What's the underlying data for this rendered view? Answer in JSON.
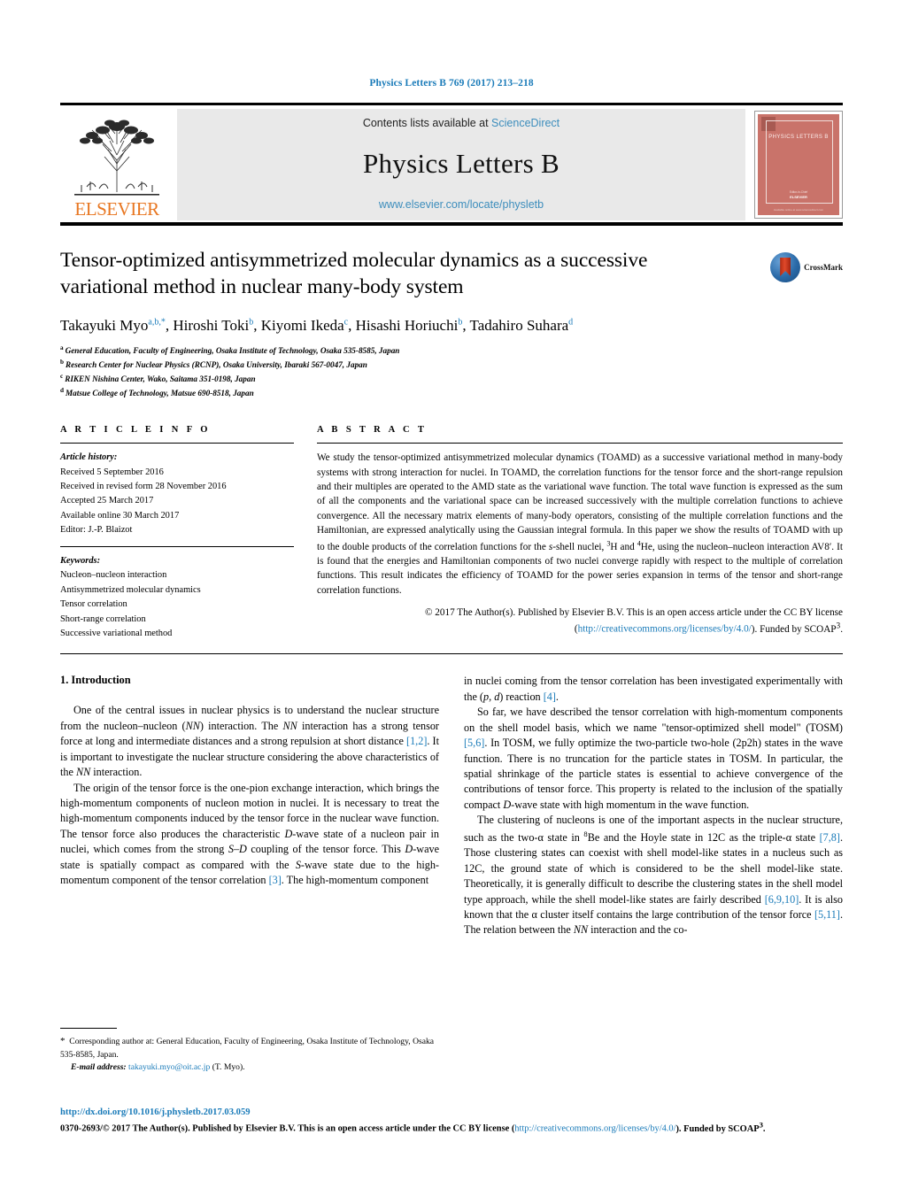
{
  "running_head": "Physics Letters B 769 (2017) 213–218",
  "masthead": {
    "contents_prefix": "Contents lists available at ",
    "contents_link": "ScienceDirect",
    "journal_title": "Physics Letters B",
    "journal_url": "www.elsevier.com/locate/physletb",
    "publisher_word": "ELSEVIER",
    "cover": {
      "title": "PHYSICS LETTERS B",
      "foot1": "Editor-in-Chief",
      "foot2": "ELSEVIER",
      "foot3": "Available online at www.sciencedirect.com"
    }
  },
  "article": {
    "title": "Tensor-optimized antisymmetrized molecular dynamics as a successive variational method in nuclear many-body system",
    "crossmark_label": "CrossMark",
    "authors": [
      {
        "name": "Takayuki Myo",
        "marks": "a,b,*"
      },
      {
        "name": "Hiroshi Toki",
        "marks": "b"
      },
      {
        "name": "Kiyomi Ikeda",
        "marks": "c"
      },
      {
        "name": "Hisashi Horiuchi",
        "marks": "b"
      },
      {
        "name": "Tadahiro Suhara",
        "marks": "d"
      }
    ],
    "affiliations": [
      {
        "mark": "a",
        "text": "General Education, Faculty of Engineering, Osaka Institute of Technology, Osaka 535-8585, Japan"
      },
      {
        "mark": "b",
        "text": "Research Center for Nuclear Physics (RCNP), Osaka University, Ibaraki 567-0047, Japan"
      },
      {
        "mark": "c",
        "text": "RIKEN Nishina Center, Wako, Saitama 351-0198, Japan"
      },
      {
        "mark": "d",
        "text": "Matsue College of Technology, Matsue 690-8518, Japan"
      }
    ]
  },
  "article_info": {
    "heading": "A R T I C L E   I N F O",
    "history_label": "Article history:",
    "history": [
      "Received 5 September 2016",
      "Received in revised form 28 November 2016",
      "Accepted 25 March 2017",
      "Available online 30 March 2017",
      "Editor: J.-P. Blaizot"
    ],
    "keywords_label": "Keywords:",
    "keywords": [
      "Nucleon–nucleon interaction",
      "Antisymmetrized molecular dynamics",
      "Tensor correlation",
      "Short-range correlation",
      "Successive variational method"
    ]
  },
  "abstract": {
    "heading": "A B S T R A C T",
    "paragraphs": [
      "We study the tensor-optimized antisymmetrized molecular dynamics (TOAMD) as a successive variational method in many-body systems with strong interaction for nuclei. In TOAMD, the correlation functions for the tensor force and the short-range repulsion and their multiples are operated to the AMD state as the variational wave function. The total wave function is expressed as the sum of all the components and the variational space can be increased successively with the multiple correlation functions to achieve convergence. All the necessary matrix elements of many-body operators, consisting of the multiple correlation functions and the Hamiltonian, are expressed analytically using the Gaussian integral formula. In this paper we show the results of TOAMD with up to the double products of the correlation functions for the s-shell nuclei, 3H and 4He, using the nucleon–nucleon interaction AV8′. It is found that the energies and Hamiltonian components of two nuclei converge rapidly with respect to the multiple of correlation functions. This result indicates the efficiency of TOAMD for the power series expansion in terms of the tensor and short-range correlation functions."
    ],
    "copyright_pre": "© 2017 The Author(s). Published by Elsevier B.V. This is an open access article under the CC BY license (",
    "copyright_link": "http://creativecommons.org/licenses/by/4.0/",
    "copyright_post": "). Funded by SCOAP3."
  },
  "body": {
    "section1_heading": "1. Introduction",
    "left_paragraphs": [
      "One of the central issues in nuclear physics is to understand the nuclear structure from the nucleon–nucleon (NN) interaction. The NN interaction has a strong tensor force at long and intermediate distances and a strong repulsion at short distance [1,2]. It is important to investigate the nuclear structure considering the above characteristics of the NN interaction.",
      "The origin of the tensor force is the one-pion exchange interaction, which brings the high-momentum components of nucleon motion in nuclei. It is necessary to treat the high-momentum components induced by the tensor force in the nuclear wave function. The tensor force also produces the characteristic D-wave state of a nucleon pair in nuclei, which comes from the strong S–D coupling of the tensor force. This D-wave state is spatially compact as compared with the S-wave state due to the high-momentum component of the tensor correlation [3]. The high-momentum component"
    ],
    "right_paragraphs": [
      "in nuclei coming from the tensor correlation has been investigated experimentally with the (p, d) reaction [4].",
      "So far, we have described the tensor correlation with high-momentum components on the shell model basis, which we name \"tensor-optimized shell model\" (TOSM) [5,6]. In TOSM, we fully optimize the two-particle two-hole (2p2h) states in the wave function. There is no truncation for the particle states in TOSM. In particular, the spatial shrinkage of the particle states is essential to achieve convergence of the contributions of tensor force. This property is related to the inclusion of the spatially compact D-wave state with high momentum in the wave function.",
      "The clustering of nucleons is one of the important aspects in the nuclear structure, such as the two-α state in 8Be and the Hoyle state in 12C as the triple-α state [7,8]. Those clustering states can coexist with shell model-like states in a nucleus such as 12C, the ground state of which is considered to be the shell model-like state. Theoretically, it is generally difficult to describe the clustering states in the shell model type approach, while the shell model-like states are fairly described [6,9,10]. It is also known that the α cluster itself contains the large contribution of the tensor force [5,11]. The relation between the NN interaction and the co-"
    ]
  },
  "footnote": {
    "star": "*",
    "corresponding": "Corresponding author at: General Education, Faculty of Engineering, Osaka Institute of Technology, Osaka 535-8585, Japan.",
    "email_label": "E-mail address:",
    "email": "takayuki.myo@oit.ac.jp",
    "email_owner": "(T. Myo)."
  },
  "page_footer": {
    "doi": "http://dx.doi.org/10.1016/j.physletb.2017.03.059",
    "issn_line_pre": "0370-2693/© 2017 The Author(s). Published by Elsevier B.V. This is an open access article under the CC BY license (",
    "issn_link": "http://creativecommons.org/licenses/by/4.0/",
    "issn_line_post": "). Funded by SCOAP3."
  },
  "colors": {
    "link": "#1a7bb9",
    "elsevier_orange": "#e87722",
    "masthead_bg": "#e9e9e9",
    "cover_red": "#c9736a"
  }
}
